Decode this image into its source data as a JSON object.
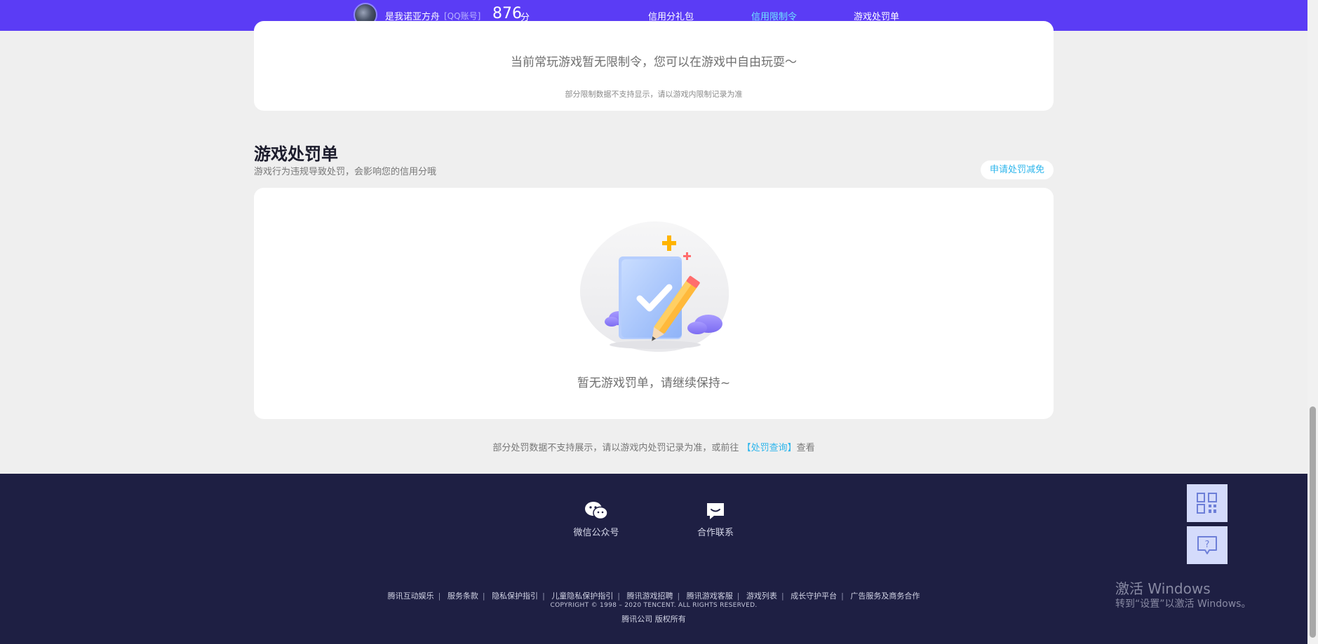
{
  "header": {
    "nickname": "是我诺亚方舟",
    "account_type": "[QQ账号]",
    "score": "876",
    "score_unit": "分",
    "nav": [
      "信用分礼包",
      "信用限制令",
      "游戏处罚单"
    ],
    "active_nav": "信用限制令"
  },
  "restriction": {
    "message": "当前常玩游戏暂无限制令，您可以在游戏中自由玩耍～",
    "note": "部分限制数据不支持显示，请以游戏内限制记录为准"
  },
  "penalty": {
    "title": "游戏处罚单",
    "desc": "游戏行为违规导致处罚，会影响您的信用分哦",
    "apply_button": "申请处罚减免",
    "empty_text": "暂无游戏罚单，请继续保持~",
    "note_prefix": "部分处罚数据不支持展示，请以游戏内处罚记录为准，或前往",
    "note_link": "【处罚查询】",
    "note_suffix": "查看"
  },
  "footer": {
    "contacts": [
      {
        "label": "微信公众号",
        "icon": "wechat-icon"
      },
      {
        "label": "合作联系",
        "icon": "message-icon"
      }
    ],
    "links": [
      "腾讯互动娱乐",
      "服务条款",
      "隐私保护指引",
      "儿童隐私保护指引",
      "腾讯游戏招聘",
      "腾讯游戏客服",
      "游戏列表",
      "成长守护平台",
      "广告服务及商务合作"
    ],
    "copyright": "COPYRIGHT © 1998 – 2020 TENCENT. ALL RIGHTS RESERVED.",
    "company": "腾讯公司 版权所有"
  },
  "side_tools": [
    "qrcode-icon",
    "feedback-icon"
  ],
  "watermark": {
    "line1": "激活 Windows",
    "line2": "转到“设置”以激活 Windows。"
  },
  "colors": {
    "nav_bg": "#5b3cf5",
    "accent": "#2eb6ec",
    "active_nav": "#6fe4ff",
    "footer_bg": "#1e1f43"
  }
}
